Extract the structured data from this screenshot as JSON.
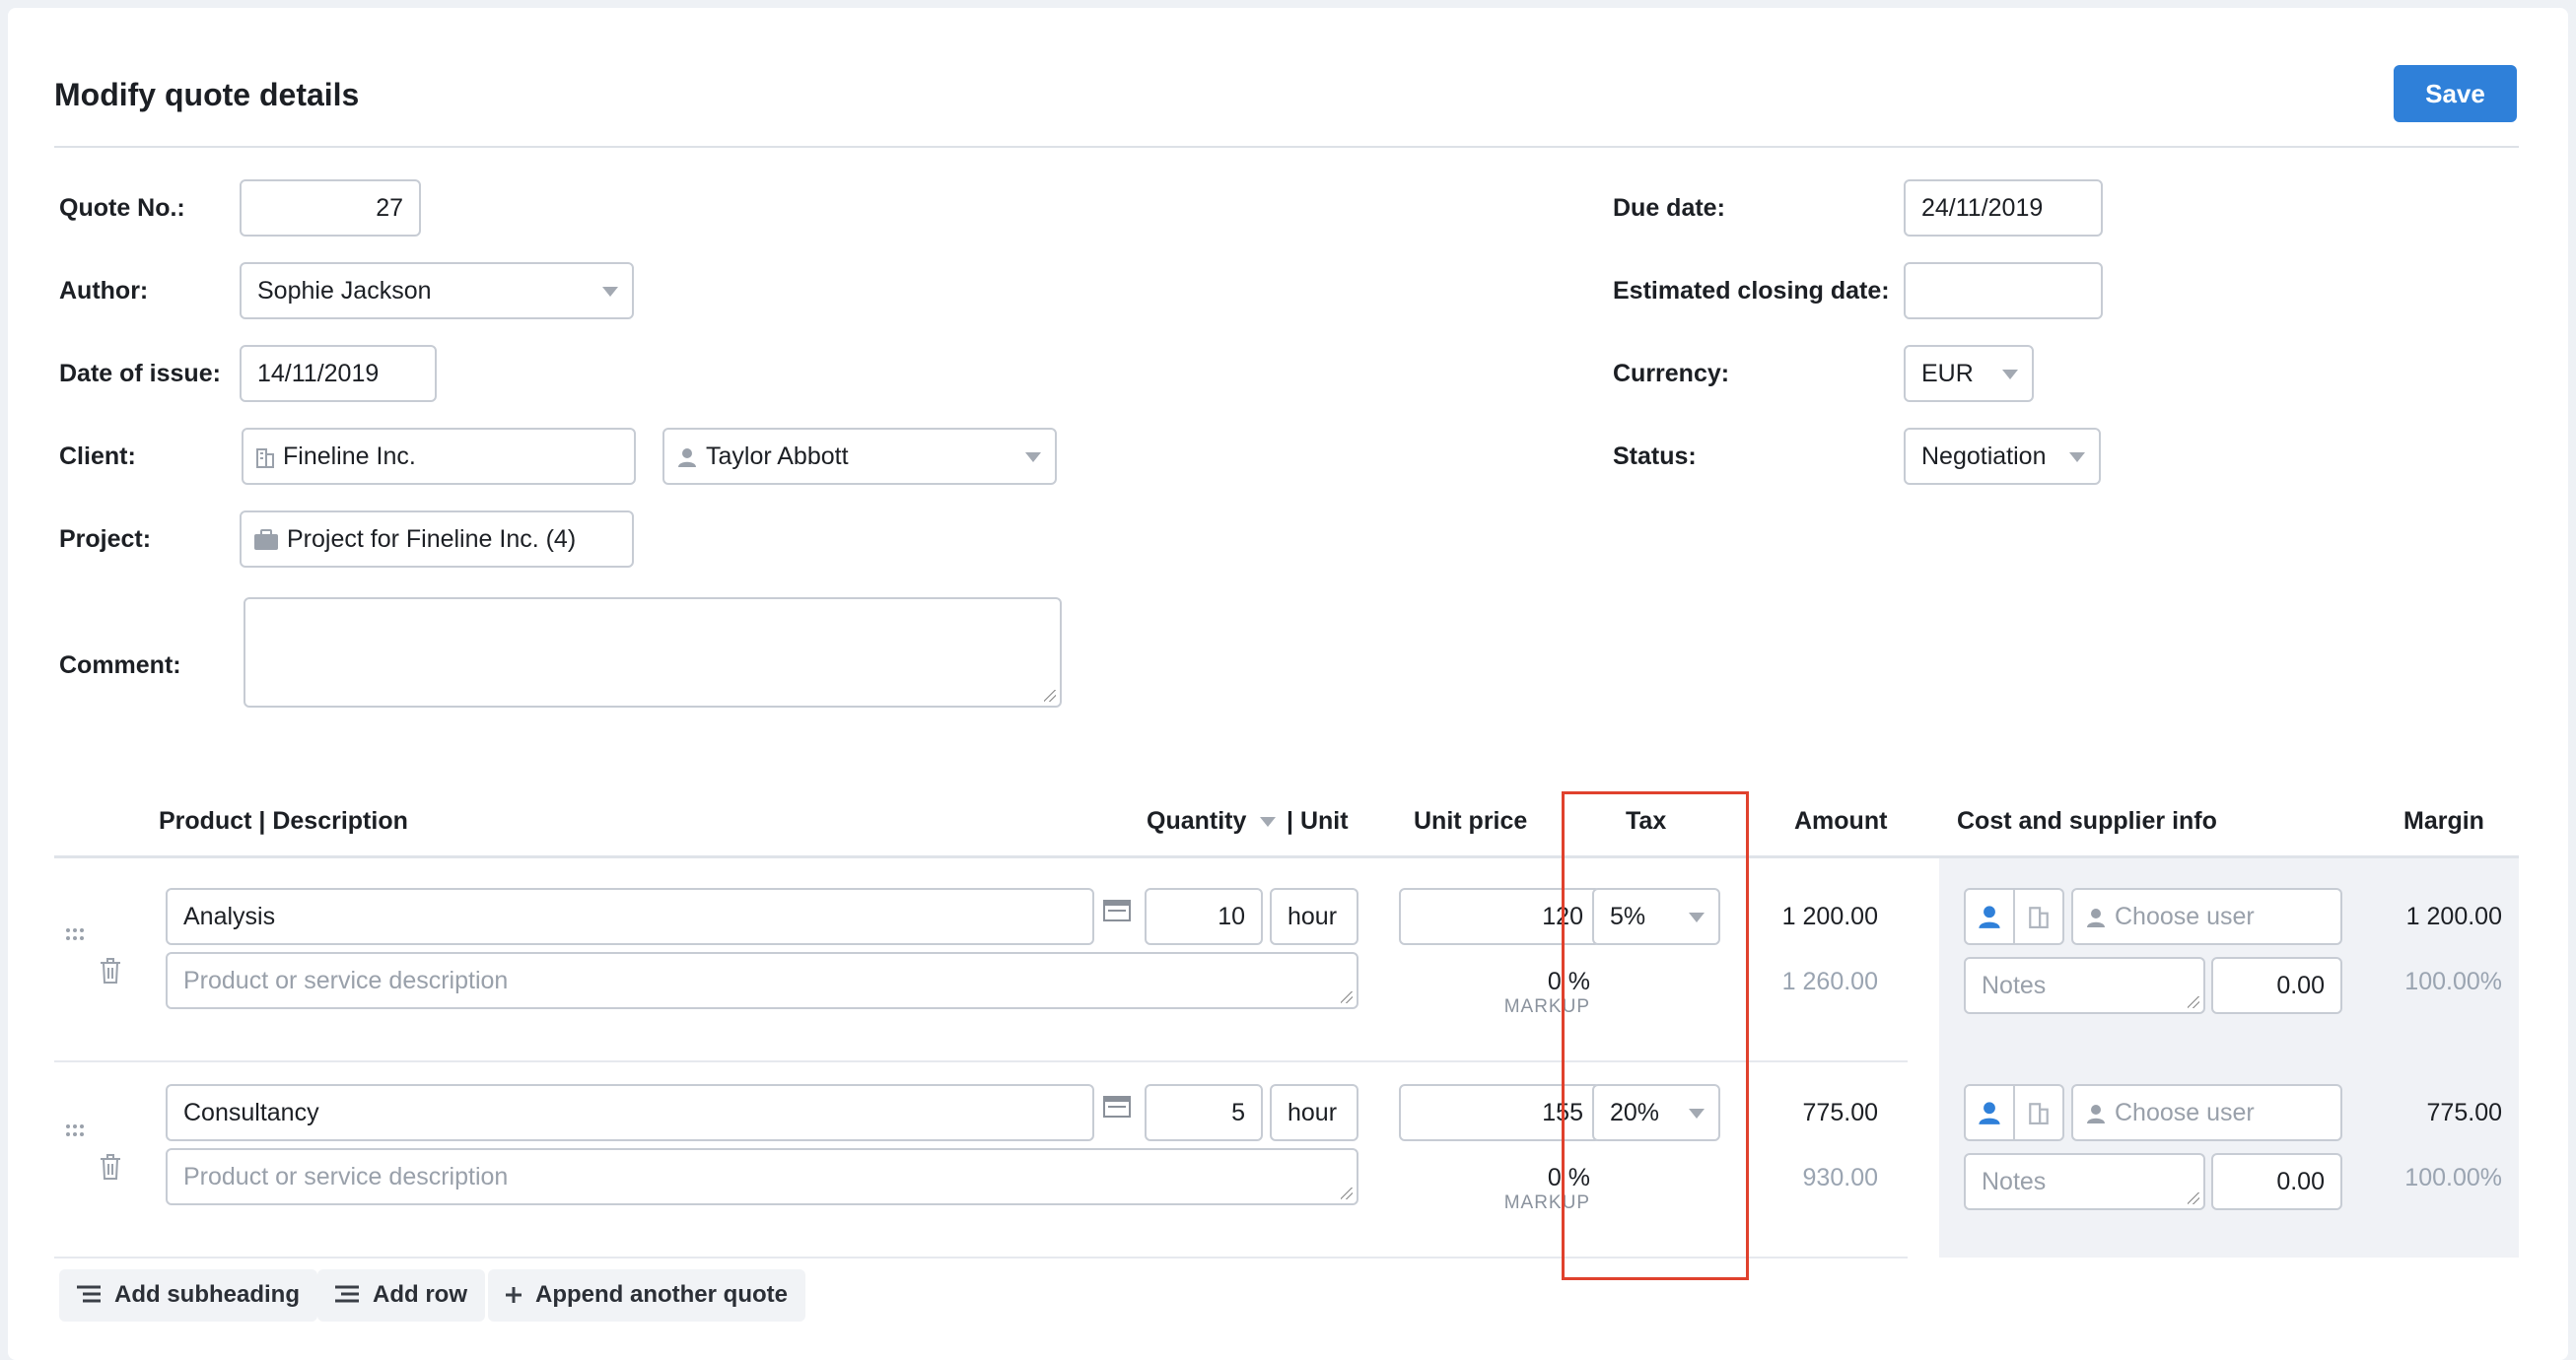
{
  "header": {
    "title": "Modify quote details",
    "save_label": "Save"
  },
  "form": {
    "quote_no": {
      "label": "Quote No.:",
      "value": "27"
    },
    "author": {
      "label": "Author:",
      "value": "Sophie Jackson"
    },
    "date_of_issue": {
      "label": "Date of issue:",
      "value": "14/11/2019"
    },
    "client": {
      "label": "Client:",
      "company": "Fineline Inc.",
      "contact": "Taylor Abbott"
    },
    "project": {
      "label": "Project:",
      "value": "Project for Fineline Inc. (4)"
    },
    "comment": {
      "label": "Comment:",
      "value": ""
    },
    "due_date": {
      "label": "Due date:",
      "value": "24/11/2019"
    },
    "estimated_closing_date": {
      "label": "Estimated closing date:",
      "value": ""
    },
    "currency": {
      "label": "Currency:",
      "value": "EUR"
    },
    "status": {
      "label": "Status:",
      "value": "Negotiation"
    }
  },
  "table": {
    "headers": {
      "product": "Product | Description",
      "quantity": "Quantity",
      "unit": "| Unit",
      "unit_price": "Unit price",
      "tax": "Tax",
      "amount": "Amount",
      "cost": "Cost and supplier info",
      "margin": "Margin"
    },
    "rows": [
      {
        "product": "Analysis",
        "description_placeholder": "Product or service description",
        "quantity": "10",
        "unit": "hour",
        "unit_price": "120",
        "markup": "0 %",
        "markup_label": "MARKUP",
        "tax": "5%",
        "amount": "1 200.00",
        "amount_with_tax": "1 260.00",
        "choose_user_placeholder": "Choose user",
        "notes_placeholder": "Notes",
        "cost": "0.00",
        "margin": "1 200.00",
        "margin_pct": "100.00%"
      },
      {
        "product": "Consultancy",
        "description_placeholder": "Product or service description",
        "quantity": "5",
        "unit": "hour",
        "unit_price": "155",
        "markup": "0 %",
        "markup_label": "MARKUP",
        "tax": "20%",
        "amount": "775.00",
        "amount_with_tax": "930.00",
        "choose_user_placeholder": "Choose user",
        "notes_placeholder": "Notes",
        "cost": "0.00",
        "margin": "775.00",
        "margin_pct": "100.00%"
      }
    ]
  },
  "actions": {
    "add_subheading": "Add subheading",
    "add_row": "Add row",
    "append_quote": "Append another quote"
  },
  "colors": {
    "accent": "#2f80d9",
    "highlight": "#e0412d"
  }
}
